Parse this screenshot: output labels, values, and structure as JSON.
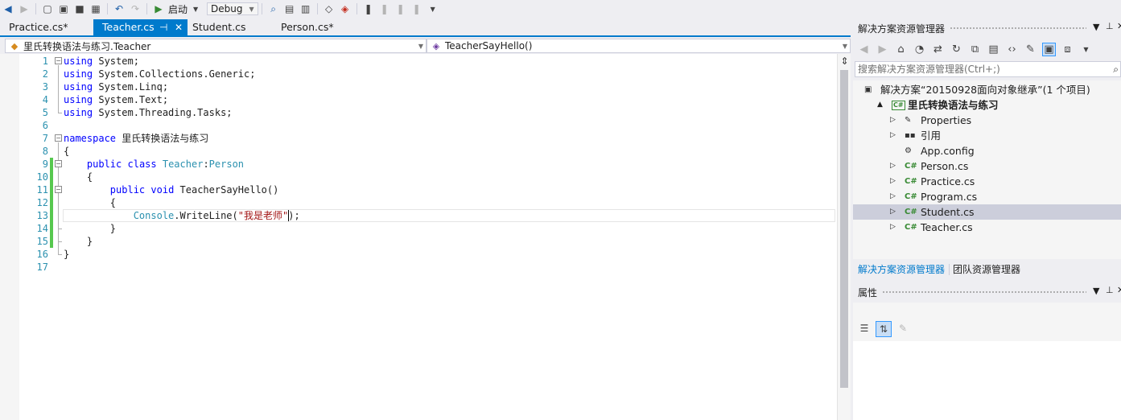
{
  "toolbar": {
    "start_label": "启动",
    "config_value": "Debug",
    "icons": [
      "nav-back-icon",
      "nav-forward-icon",
      "new-project-icon",
      "open-file-icon",
      "save-icon",
      "save-all-icon",
      "undo-icon",
      "redo-icon",
      "start-icon",
      "find-icon",
      "bookmark-icon"
    ]
  },
  "tabs": [
    {
      "label": "Practice.cs*",
      "active": false
    },
    {
      "label": "Teacher.cs",
      "active": true
    },
    {
      "label": "Student.cs",
      "active": false
    },
    {
      "label": "Person.cs*",
      "active": false
    }
  ],
  "navbar": {
    "type_value": "里氏转换语法与练习.Teacher",
    "member_value": "TeacherSayHello()"
  },
  "editor": {
    "line_numbers": [
      "1",
      "2",
      "3",
      "4",
      "5",
      "6",
      "7",
      "8",
      "9",
      "10",
      "11",
      "12",
      "13",
      "14",
      "15",
      "16",
      "17"
    ],
    "lines": [
      {
        "tokens": [
          {
            "t": "using",
            "c": "kw"
          },
          {
            "t": " System;",
            "c": ""
          }
        ]
      },
      {
        "tokens": [
          {
            "t": "using",
            "c": "kw"
          },
          {
            "t": " System.Collections.Generic;",
            "c": ""
          }
        ]
      },
      {
        "tokens": [
          {
            "t": "using",
            "c": "kw"
          },
          {
            "t": " System.Linq;",
            "c": ""
          }
        ]
      },
      {
        "tokens": [
          {
            "t": "using",
            "c": "kw"
          },
          {
            "t": " System.Text;",
            "c": ""
          }
        ]
      },
      {
        "tokens": [
          {
            "t": "using",
            "c": "kw"
          },
          {
            "t": " System.Threading.Tasks;",
            "c": ""
          }
        ]
      },
      {
        "tokens": []
      },
      {
        "tokens": [
          {
            "t": "namespace",
            "c": "kw"
          },
          {
            "t": " 里氏转换语法与练习",
            "c": ""
          }
        ]
      },
      {
        "tokens": [
          {
            "t": "{",
            "c": ""
          }
        ]
      },
      {
        "tokens": [
          {
            "t": "    ",
            "c": ""
          },
          {
            "t": "public",
            "c": "kw"
          },
          {
            "t": " ",
            "c": ""
          },
          {
            "t": "class",
            "c": "kw"
          },
          {
            "t": " ",
            "c": ""
          },
          {
            "t": "Teacher",
            "c": "ty"
          },
          {
            "t": ":",
            "c": ""
          },
          {
            "t": "Person",
            "c": "ty"
          }
        ]
      },
      {
        "tokens": [
          {
            "t": "    {",
            "c": ""
          }
        ]
      },
      {
        "tokens": [
          {
            "t": "        ",
            "c": ""
          },
          {
            "t": "public",
            "c": "kw"
          },
          {
            "t": " ",
            "c": ""
          },
          {
            "t": "void",
            "c": "kw"
          },
          {
            "t": " TeacherSayHello()",
            "c": ""
          }
        ]
      },
      {
        "tokens": [
          {
            "t": "        {",
            "c": ""
          }
        ]
      },
      {
        "tokens": [
          {
            "t": "            ",
            "c": ""
          },
          {
            "t": "Console",
            "c": "ty"
          },
          {
            "t": ".WriteLine(",
            "c": ""
          },
          {
            "t": "\"我是老师\"",
            "c": "st"
          },
          {
            "t": ");",
            "c": ""
          }
        ]
      },
      {
        "tokens": [
          {
            "t": "        }",
            "c": ""
          }
        ]
      },
      {
        "tokens": [
          {
            "t": "    }",
            "c": ""
          }
        ]
      },
      {
        "tokens": [
          {
            "t": "}",
            "c": ""
          }
        ]
      },
      {
        "tokens": []
      }
    ]
  },
  "solution_explorer": {
    "title": "解决方案资源管理器",
    "search_placeholder": "搜索解决方案资源管理器(Ctrl+;)",
    "tree": [
      {
        "label": "解决方案“20150928面向对象继承”(1 个项目)",
        "icon": "solution-icon",
        "level": 0,
        "expander": "",
        "bold": false,
        "selected": false
      },
      {
        "label": "里氏转换语法与练习",
        "icon": "csharp-project-icon",
        "level": 1,
        "expander": "▲",
        "bold": true,
        "selected": false
      },
      {
        "label": "Properties",
        "icon": "wrench-icon",
        "level": 2,
        "expander": "▷",
        "bold": false,
        "selected": false
      },
      {
        "label": "引用",
        "icon": "references-icon",
        "level": 2,
        "expander": "▷",
        "bold": false,
        "selected": false
      },
      {
        "label": "App.config",
        "icon": "config-file-icon",
        "level": 2,
        "expander": "",
        "bold": false,
        "selected": false
      },
      {
        "label": "Person.cs",
        "icon": "csharp-file-icon",
        "level": 2,
        "expander": "▷",
        "bold": false,
        "selected": false
      },
      {
        "label": "Practice.cs",
        "icon": "csharp-file-icon",
        "level": 2,
        "expander": "▷",
        "bold": false,
        "selected": false
      },
      {
        "label": "Program.cs",
        "icon": "csharp-file-icon",
        "level": 2,
        "expander": "▷",
        "bold": false,
        "selected": false
      },
      {
        "label": "Student.cs",
        "icon": "csharp-file-icon",
        "level": 2,
        "expander": "▷",
        "bold": false,
        "selected": true
      },
      {
        "label": "Teacher.cs",
        "icon": "csharp-file-icon",
        "level": 2,
        "expander": "▷",
        "bold": false,
        "selected": false
      }
    ],
    "bottom_tabs": [
      "解决方案资源管理器",
      "团队资源管理器"
    ]
  },
  "properties": {
    "title": "属性"
  },
  "colors": {
    "accent": "#007ACC",
    "keyword": "#0000FF",
    "type": "#2B91AF",
    "string": "#A31515",
    "change_margin": "#57C84F"
  }
}
